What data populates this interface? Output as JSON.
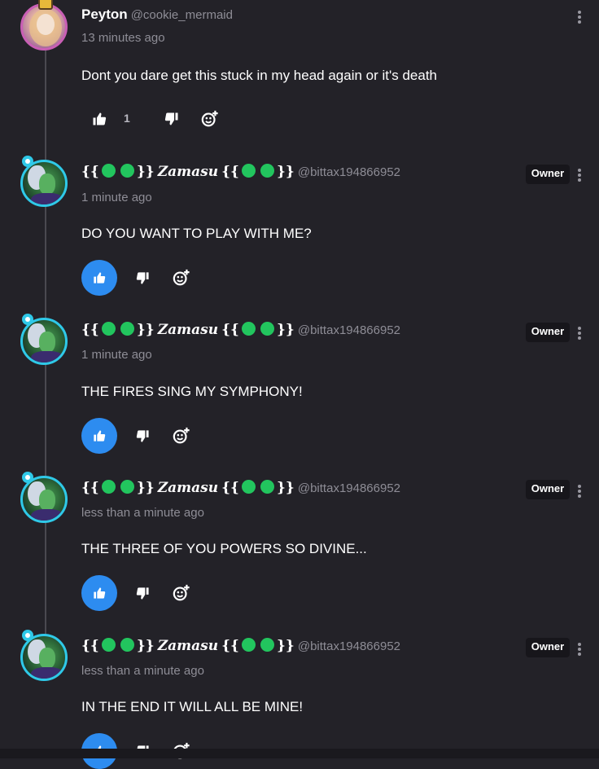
{
  "comments": [
    {
      "author_name": "Peyton",
      "handle": "@cookie_mermaid",
      "time": "13 minutes ago",
      "text": "Dont you dare get this stuck in my head again or it's death",
      "like_count": "1",
      "liked": false,
      "owner_badge": ""
    },
    {
      "author_name": "Zamasu",
      "name_prefix": "{{",
      "name_suffix": "}}",
      "handle": "@bittax194866952",
      "time": "1 minute ago",
      "text": "DO YOU WANT TO PLAY WITH ME?",
      "liked": true,
      "owner_badge": "Owner"
    },
    {
      "author_name": "Zamasu",
      "name_prefix": "{{",
      "name_suffix": "}}",
      "handle": "@bittax194866952",
      "time": "1 minute ago",
      "text": "THE FIRES SING MY SYMPHONY!",
      "liked": true,
      "owner_badge": "Owner"
    },
    {
      "author_name": "Zamasu",
      "name_prefix": "{{",
      "name_suffix": "}}",
      "handle": "@bittax194866952",
      "time": "less than a minute ago",
      "text": "THE THREE OF YOU POWERS SO DIVINE...",
      "liked": true,
      "owner_badge": "Owner"
    },
    {
      "author_name": "Zamasu",
      "name_prefix": "{{",
      "name_suffix": "}}",
      "handle": "@bittax194866952",
      "time": "less than a minute ago",
      "text": "IN THE END IT WILL ALL BE MINE!",
      "liked": true,
      "owner_badge": "Owner"
    }
  ],
  "colors": {
    "background": "#232228",
    "accent_like": "#2d8cf0",
    "name_dot": "#22c55e",
    "avatar_ring_owner": "#2fc9e8",
    "avatar_ring_peyton": "#c95fb5"
  },
  "icons": [
    "thumbs-up-icon",
    "thumbs-down-icon",
    "add-reaction-icon",
    "more-vertical-icon"
  ]
}
